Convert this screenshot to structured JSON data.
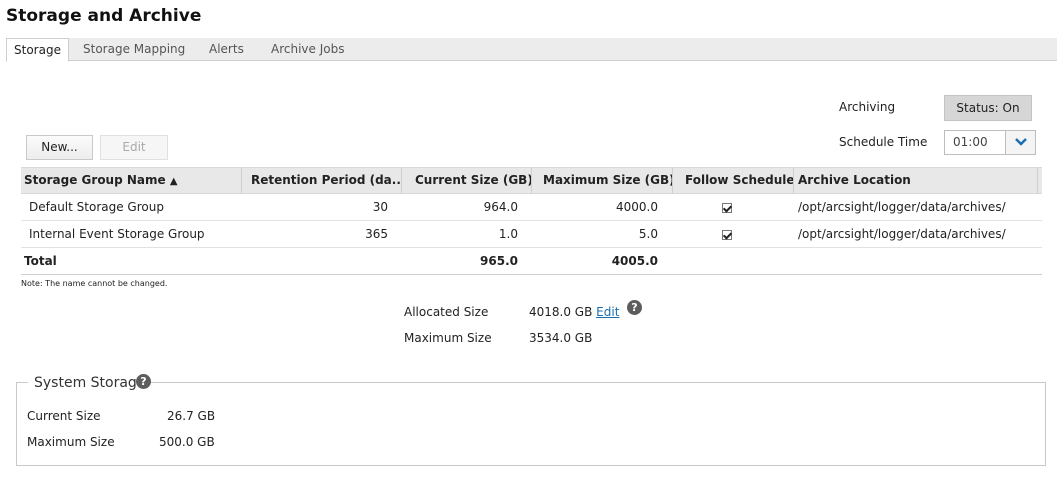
{
  "page": {
    "title": "Storage and Archive"
  },
  "tabs": [
    {
      "label": "Storage",
      "active": true
    },
    {
      "label": "Storage Mapping",
      "active": false
    },
    {
      "label": "Alerts",
      "active": false
    },
    {
      "label": "Archive Jobs",
      "active": false
    }
  ],
  "archiving": {
    "label": "Archiving",
    "status_button": "Status: On"
  },
  "schedule": {
    "label": "Schedule Time",
    "value": "01:00"
  },
  "toolbar": {
    "new_label": "New...",
    "edit_label": "Edit"
  },
  "table": {
    "columns": [
      "Storage Group Name",
      "Retention Period (da...",
      "Current Size (GB)",
      "Maximum Size (GB)",
      "Follow Schedule",
      "Archive Location"
    ],
    "sort_indicator": "▲",
    "rows": [
      {
        "name": "Default Storage Group",
        "retention": "30",
        "current": "964.0",
        "maximum": "4000.0",
        "follow": true,
        "location": "/opt/arcsight/logger/data/archives/"
      },
      {
        "name": "Internal Event Storage Group",
        "retention": "365",
        "current": "1.0",
        "maximum": "5.0",
        "follow": true,
        "location": "/opt/arcsight/logger/data/archives/"
      }
    ],
    "total": {
      "label": "Total",
      "current": "965.0",
      "maximum": "4005.0"
    }
  },
  "note": "Note: The name cannot be changed.",
  "allocation": {
    "allocated_label": "Allocated Size",
    "allocated_value": "4018.0 GB",
    "edit_link": "Edit",
    "maximum_label": "Maximum Size",
    "maximum_value": "3534.0 GB"
  },
  "system_storage": {
    "title": "System Storage",
    "current_label": "Current Size",
    "current_value": "26.7 GB",
    "maximum_label": "Maximum Size",
    "maximum_value": "500.0 GB"
  },
  "icons": {
    "help": "?"
  },
  "colors": {
    "link": "#1a6fb3",
    "header_bg": "#e8e8e8",
    "status_btn_bg": "#d6d6d6"
  }
}
